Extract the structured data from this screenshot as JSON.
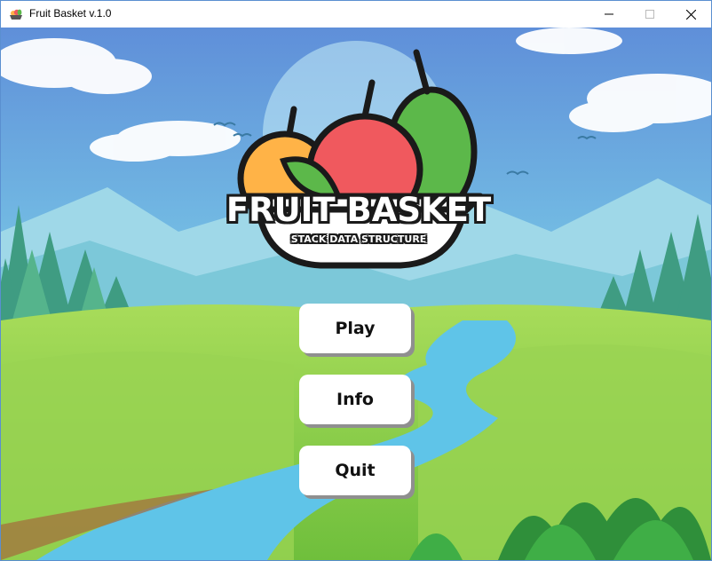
{
  "window": {
    "title": "Fruit Basket v.1.0",
    "controls": {
      "minimize": "minimize",
      "maximize": "maximize",
      "close": "close"
    }
  },
  "logo": {
    "title": "FRUIT BASKET",
    "subtitle": "STACK DATA STRUCTURE"
  },
  "menu": {
    "play_label": "Play",
    "info_label": "Info",
    "quit_label": "Quit"
  },
  "colors": {
    "sky": "#6ec6e6",
    "grass": "#8fd14f",
    "river": "#5fc4e8",
    "button_bg": "#ffffff",
    "button_shadow": "#8f8f8f",
    "apple": "#f0595e",
    "orange": "#ffb347",
    "pear": "#5cb84a"
  }
}
